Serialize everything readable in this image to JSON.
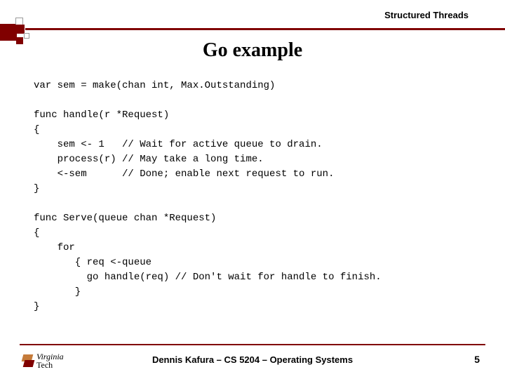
{
  "header": {
    "label": "Structured Threads"
  },
  "title": "Go example",
  "code": {
    "line1": "var sem = make(chan int, Max.Outstanding)",
    "line2": "func handle(r *Request)",
    "line3": "{",
    "line4": "    sem <- 1   // Wait for active queue to drain.",
    "line5": "    process(r) // May take a long time.",
    "line6": "    <-sem      // Done; enable next request to run.",
    "line7": "}",
    "line8": "func Serve(queue chan *Request)",
    "line9": "{",
    "line10": "    for",
    "line11": "       { req <-queue",
    "line12": "         go handle(req) // Don't wait for handle to finish.",
    "line13": "       }",
    "line14": "}"
  },
  "footer": {
    "text": "Dennis Kafura – CS 5204 – Operating Systems",
    "page": "5",
    "logo": {
      "line1": "Virginia",
      "line2": "Tech"
    }
  }
}
